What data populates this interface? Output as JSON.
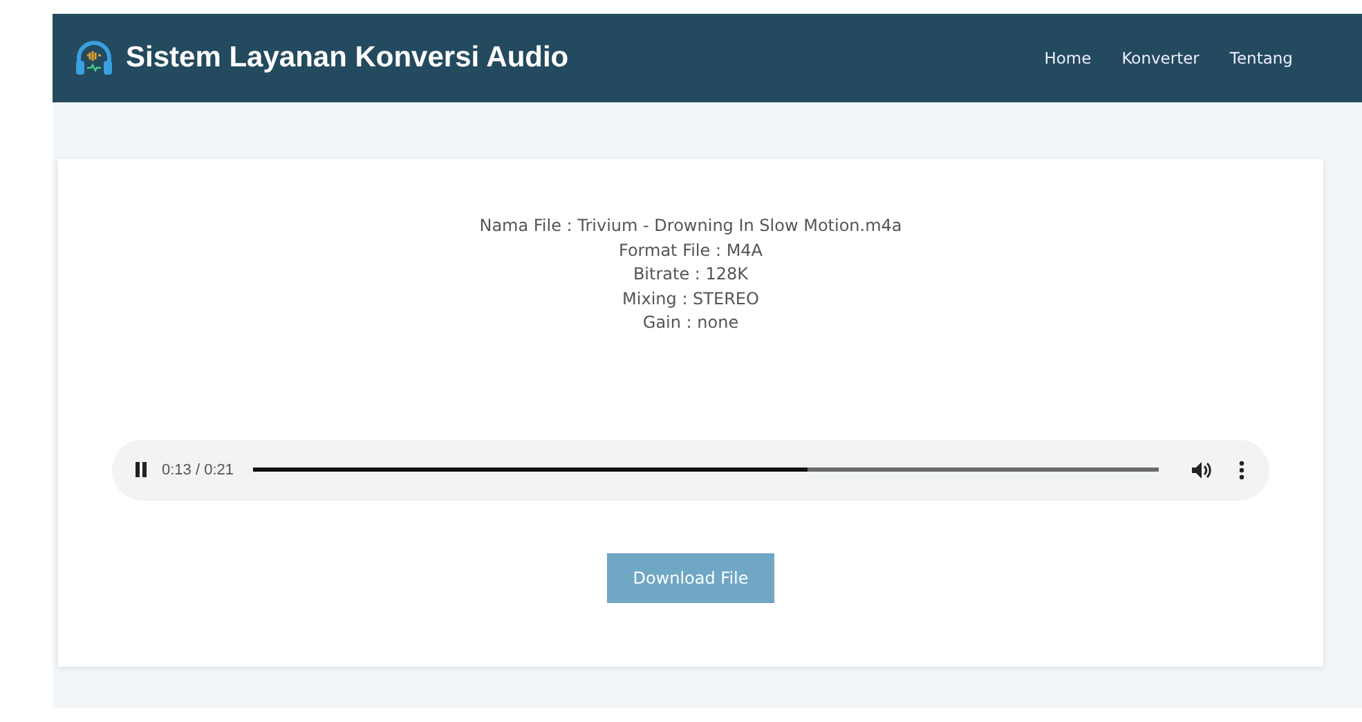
{
  "header": {
    "title": "Sistem Layanan Konversi Audio",
    "nav": [
      {
        "label": "Home"
      },
      {
        "label": "Konverter"
      },
      {
        "label": "Tentang"
      }
    ]
  },
  "file_info": [
    "Nama File : Trivium - Drowning In Slow Motion.m4a",
    "Format File : M4A",
    "Bitrate : 128K",
    "Mixing : STEREO",
    "Gain : none"
  ],
  "player": {
    "playing": true,
    "time": "0:13 / 0:21",
    "level": 0.612
  },
  "download_button": "Download File"
}
